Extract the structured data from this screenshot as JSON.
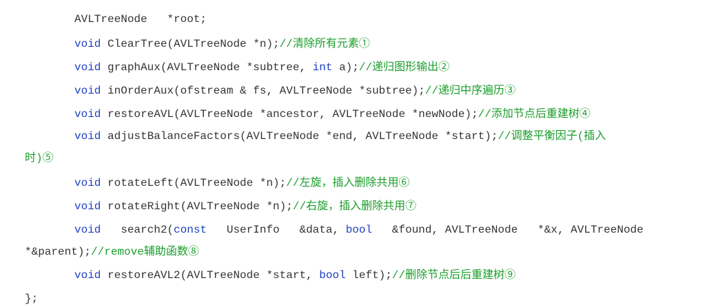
{
  "lines": [
    {
      "segments": [
        {
          "t": "tx",
          "text": "AVLTreeNode   *root;"
        }
      ]
    },
    {
      "segments": [
        {
          "t": "kw",
          "text": "void"
        },
        {
          "t": "tx",
          "text": " ClearTree(AVLTreeNode *n);"
        },
        {
          "t": "cm",
          "text": "//清除所有元素①"
        }
      ]
    },
    {
      "segments": [
        {
          "t": "kw",
          "text": "void"
        },
        {
          "t": "tx",
          "text": " graphAux(AVLTreeNode *subtree, "
        },
        {
          "t": "kw",
          "text": "int"
        },
        {
          "t": "tx",
          "text": " a);"
        },
        {
          "t": "cm",
          "text": "//递归图形输出②"
        }
      ]
    },
    {
      "segments": [
        {
          "t": "kw",
          "text": "void"
        },
        {
          "t": "tx",
          "text": " inOrderAux(ofstream & fs, AVLTreeNode *subtree);"
        },
        {
          "t": "cm",
          "text": "//递归中序遍历③"
        }
      ]
    },
    {
      "segments": [
        {
          "t": "kw",
          "text": "void"
        },
        {
          "t": "tx",
          "text": " restoreAVL(AVLTreeNode *ancestor, AVLTreeNode *newNode);"
        },
        {
          "t": "cm",
          "text": "//添加节点后重建树④"
        }
      ]
    },
    {
      "segments": [
        {
          "t": "kw",
          "text": "void"
        },
        {
          "t": "tx",
          "text": " adjustBalanceFactors(AVLTreeNode *end, AVLTreeNode *start);"
        },
        {
          "t": "cm",
          "text": "//调整平衡因子(插入"
        }
      ]
    },
    {
      "segments": [
        {
          "t": "cm",
          "text": "时)⑤"
        }
      ]
    },
    {
      "segments": [
        {
          "t": "kw",
          "text": "void"
        },
        {
          "t": "tx",
          "text": " rotateLeft(AVLTreeNode *n);"
        },
        {
          "t": "cm",
          "text": "//左旋，插入删除共用⑥"
        }
      ]
    },
    {
      "segments": [
        {
          "t": "kw",
          "text": "void"
        },
        {
          "t": "tx",
          "text": " rotateRight(AVLTreeNode *n);"
        },
        {
          "t": "cm",
          "text": "//右旋，插入删除共用⑦"
        }
      ]
    },
    {
      "segments": [
        {
          "t": "kw",
          "text": "void"
        },
        {
          "t": "tx",
          "text": "   search2("
        },
        {
          "t": "kw",
          "text": "const"
        },
        {
          "t": "tx",
          "text": "   UserInfo   &data, "
        },
        {
          "t": "kw",
          "text": "bool"
        },
        {
          "t": "tx",
          "text": "   &found, AVLTreeNode   *&x, AVLTreeNode"
        }
      ]
    },
    {
      "segments": [
        {
          "t": "tx",
          "text": "*&parent);"
        },
        {
          "t": "cm",
          "text": "//remove辅助函数⑧"
        }
      ]
    },
    {
      "segments": [
        {
          "t": "kw",
          "text": "void"
        },
        {
          "t": "tx",
          "text": " restoreAVL2(AVLTreeNode *start, "
        },
        {
          "t": "kw",
          "text": "bool"
        },
        {
          "t": "tx",
          "text": " left);"
        },
        {
          "t": "cm",
          "text": "//删除节点后后重建树⑨"
        }
      ]
    },
    {
      "segments": [
        {
          "t": "tx",
          "text": "};"
        }
      ]
    }
  ]
}
